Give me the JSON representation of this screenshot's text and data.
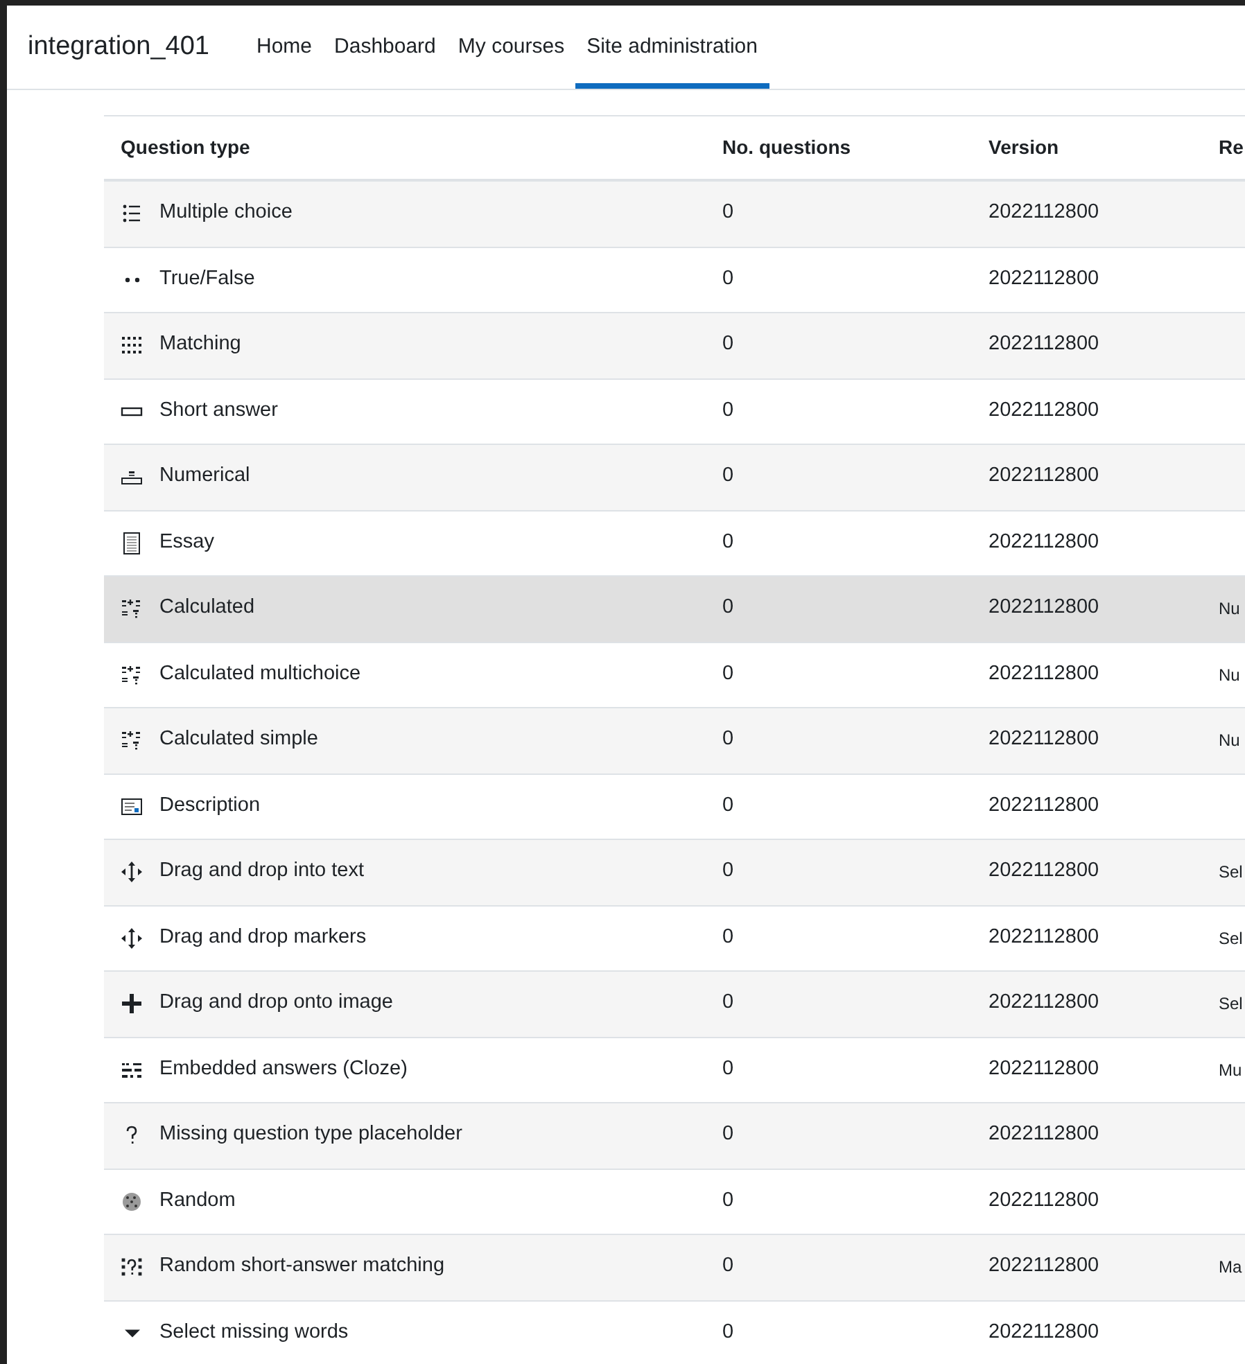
{
  "navbar": {
    "brand": "integration_401",
    "items": [
      {
        "label": "Home",
        "selected": false
      },
      {
        "label": "Dashboard",
        "selected": false
      },
      {
        "label": "My courses",
        "selected": false
      },
      {
        "label": "Site administration",
        "selected": true
      }
    ]
  },
  "table": {
    "columns": [
      "Question type",
      "No. questions",
      "Version",
      "Re"
    ],
    "rows": [
      {
        "kind": "multichoice",
        "name": "Multiple choice",
        "count": "0",
        "version": "2022112800",
        "hovered": false
      },
      {
        "kind": "truefalse",
        "name": "True/False",
        "count": "0",
        "version": "2022112800",
        "hovered": false
      },
      {
        "kind": "match",
        "name": "Matching",
        "count": "0",
        "version": "2022112800",
        "hovered": false
      },
      {
        "kind": "shortanswer",
        "name": "Short answer",
        "count": "0",
        "version": "2022112800",
        "hovered": false
      },
      {
        "kind": "numerical",
        "name": "Numerical",
        "count": "0",
        "version": "2022112800",
        "hovered": false
      },
      {
        "kind": "essay",
        "name": "Essay",
        "count": "0",
        "version": "2022112800",
        "hovered": false
      },
      {
        "kind": "calculated",
        "name": "Calculated",
        "count": "0",
        "version": "2022112800",
        "requires": "Nu",
        "hovered": true
      },
      {
        "kind": "calculated",
        "name": "Calculated multichoice",
        "count": "0",
        "version": "2022112800",
        "requires": "Nu",
        "hovered": false
      },
      {
        "kind": "calculated",
        "name": "Calculated simple",
        "count": "0",
        "version": "2022112800",
        "requires": "Nu",
        "hovered": false
      },
      {
        "kind": "description",
        "name": "Description",
        "count": "0",
        "version": "2022112800",
        "hovered": false
      },
      {
        "kind": "move",
        "name": "Drag and drop into text",
        "count": "0",
        "version": "2022112800",
        "requires": "Sel",
        "hovered": false
      },
      {
        "kind": "move",
        "name": "Drag and drop markers",
        "count": "0",
        "version": "2022112800",
        "requires": "Sel",
        "hovered": false
      },
      {
        "kind": "cross",
        "name": "Drag and drop onto image",
        "count": "0",
        "version": "2022112800",
        "requires": "Sel",
        "hovered": false
      },
      {
        "kind": "cloze",
        "name": "Embedded answers (Cloze)",
        "count": "0",
        "version": "2022112800",
        "requires": "Mu",
        "hovered": false
      },
      {
        "kind": "missing",
        "name": "Missing question type placeholder",
        "count": "0",
        "version": "2022112800",
        "hovered": false
      },
      {
        "kind": "random",
        "name": "Random",
        "count": "0",
        "version": "2022112800",
        "hovered": false
      },
      {
        "kind": "randommatch",
        "name": "Random short-answer matching",
        "count": "0",
        "version": "2022112800",
        "requires": "Ma",
        "hovered": false
      },
      {
        "kind": "gapselect",
        "name": "Select missing words",
        "count": "0",
        "version": "2022112800",
        "hovered": false
      }
    ]
  }
}
